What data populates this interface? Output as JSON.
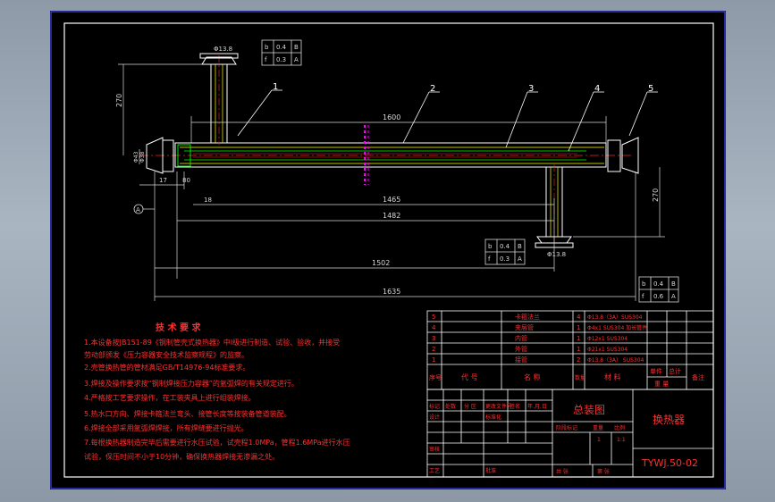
{
  "drawing": {
    "parts_callouts": [
      "1",
      "2",
      "3",
      "4",
      "5"
    ],
    "dims": {
      "d_top_flange": "Φ13.8",
      "d_bottom_flange": "Φ13.8",
      "len_1600": "1600",
      "len_1465": "1465",
      "len_1482": "1482",
      "len_1502": "1502",
      "len_1635": "1635",
      "h_left": "270",
      "h_right": "270",
      "dim_17": "17",
      "dim_80": "80",
      "dim_18": "18",
      "d_left_a": "Φ43",
      "d_left_b": "Φ38",
      "datum_a": "A"
    },
    "tol_frames": {
      "top": [
        [
          "b",
          "0.4",
          "B"
        ],
        [
          "f",
          "0.3",
          "A"
        ]
      ],
      "mid": [
        [
          "b",
          "0.4",
          "B"
        ],
        [
          "f",
          "0.3",
          "A"
        ]
      ],
      "right": [
        [
          "b",
          "0.4",
          "B"
        ],
        [
          "f",
          "0.6",
          "A"
        ]
      ]
    }
  },
  "notes": {
    "title": "技 术 要 求",
    "lines": [
      "1.本设备按JB151-89《钢制管壳式换热器》中Ⅰ级进行制造、试验、验收，并接受",
      "劳动部颁发《压力容器安全技术监察规程》的监察。",
      "2.壳管换热管的管材满足GB/T14976-94标准要求。",
      "3.焊接及操作要求按“钢制焊接压力容器”的氩弧焊的有关规定进行。",
      "4.严格按工艺要求操作，在工装夹具上进行组装焊接。",
      "5.热水口方向、焊接卡箍法兰弯头、接管长度等按装备管道装配。",
      "6.焊接全部采用氩弧焊焊接，所有焊缝要进行抛光。",
      "7.每根换热器制造完毕后需要进行水压试验，试壳程1.0MPa，管程1.6MPa进行水压",
      "试验，保压时间不小于10分钟，确保换热器焊接无渗漏之处。"
    ]
  },
  "bom": {
    "rows": [
      {
        "no": "5",
        "code": "",
        "name": "卡箍法兰",
        "qty": "4",
        "material": "Φ13.8（3A）SUS304",
        "weight": "",
        "remark": ""
      },
      {
        "no": "4",
        "code": "",
        "name": "夹层管",
        "qty": "1",
        "material": "Φ4x1 SUS304 加长管件",
        "weight": "",
        "remark": ""
      },
      {
        "no": "3",
        "code": "",
        "name": "内管",
        "qty": "1",
        "material": "Φ12x1 SUS304",
        "weight": "",
        "remark": ""
      },
      {
        "no": "2",
        "code": "",
        "name": "外管",
        "qty": "1",
        "material": "Φ21x1 SUS304",
        "weight": "",
        "remark": ""
      },
      {
        "no": "1",
        "code": "",
        "name": "接管",
        "qty": "2",
        "material": "Φ13.8（3A） SUS304",
        "weight": "",
        "remark": ""
      }
    ],
    "header": {
      "no": "序号",
      "code": "代 号",
      "name": "名 称",
      "qty": "数量",
      "material": "材 料",
      "unit": "单件",
      "total": "总计",
      "weight": "重 量",
      "remark": "备注"
    }
  },
  "title_block": {
    "drawing_name": "总装图",
    "product": "换热器",
    "drawing_no": "TYWJ.50-02",
    "labels": {
      "mark": "标记",
      "count": "处数",
      "zone": "分 区",
      "change_doc": "更改文件号",
      "sign": "签名",
      "date": "年.月.日",
      "design": "设计",
      "standard": "标准化",
      "review": "审核",
      "process": "工艺",
      "approve": "批准",
      "stage": "阶段标记",
      "weight": "重量",
      "scale": "比例",
      "sheets_total": "共  张",
      "sheet_no": "第  张"
    },
    "scale": "1:1",
    "qty": "1"
  },
  "colors": {
    "line_white": "#ffffff",
    "line_yellow": "#ffff00",
    "line_green": "#00ff00",
    "line_red": "#ff2020",
    "dim_white": "#d8d8d8",
    "frame_blue": "#3f48ff",
    "magenta": "#ff00ff",
    "note_red": "#ff3030"
  }
}
